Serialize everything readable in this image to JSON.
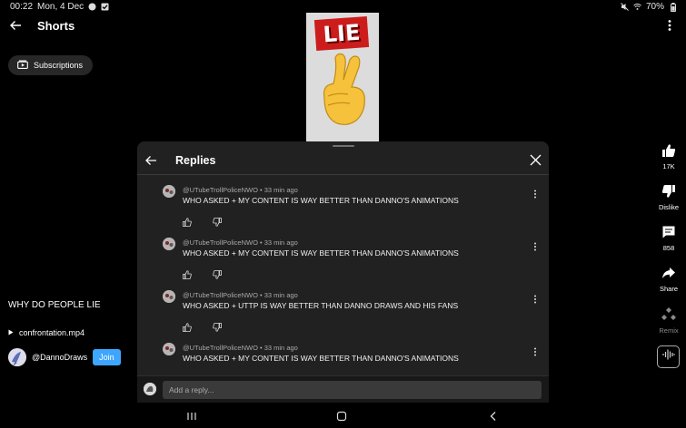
{
  "status_bar": {
    "time": "00:22",
    "date": "Mon, 4 Dec",
    "battery": "70%"
  },
  "header": {
    "title": "Shorts"
  },
  "subscriptions": {
    "label": "Subscriptions"
  },
  "thumbnail": {
    "text": "LIE"
  },
  "video": {
    "title": "WHY DO PEOPLE LIE",
    "music": "confrontation.mp4",
    "channel": "@DannoDraws",
    "join_label": "Join"
  },
  "actions": {
    "like_count": "17K",
    "dislike_label": "Dislike",
    "comment_count": "858",
    "share_label": "Share",
    "remix_label": "Remix"
  },
  "replies_panel": {
    "title": "Replies",
    "items": [
      {
        "author": "@UTubeTrollPoliceNWO",
        "time": "33 min ago",
        "text": "WHO ASKED + MY CONTENT IS WAY BETTER THAN DANNO'S ANIMATIONS"
      },
      {
        "author": "@UTubeTrollPoliceNWO",
        "time": "33 min ago",
        "text": "WHO ASKED + MY CONTENT IS WAY BETTER THAN DANNO'S ANIMATIONS"
      },
      {
        "author": "@UTubeTrollPoliceNWO",
        "time": "33 min ago",
        "text": "WHO ASKED + UTTP IS WAY BETTER THAN DANNO DRAWS AND HIS FANS"
      },
      {
        "author": "@UTubeTrollPoliceNWO",
        "time": "33 min ago",
        "text": "WHO ASKED + MY CONTENT IS WAY BETTER THAN DANNO'S ANIMATIONS"
      }
    ],
    "input_placeholder": "Add a reply..."
  },
  "colors": {
    "background": "#000000",
    "panel": "#212121",
    "join": "#3ea6ff"
  }
}
